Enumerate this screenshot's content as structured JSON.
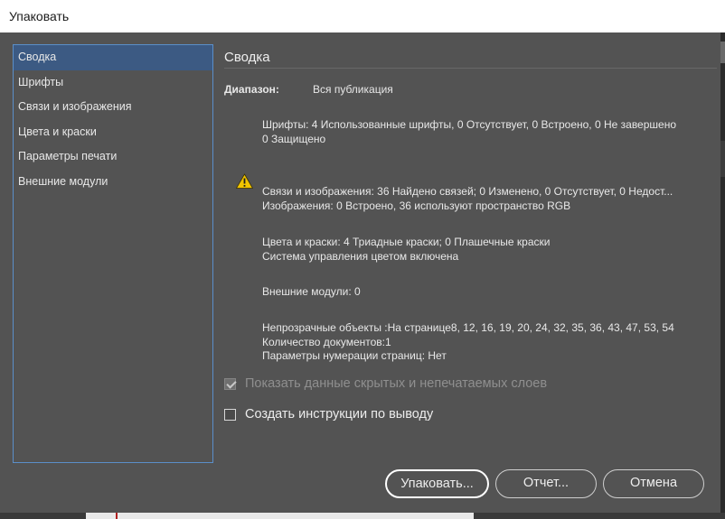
{
  "window": {
    "title": "Упаковать"
  },
  "sidebar": {
    "items": [
      {
        "label": "Сводка",
        "selected": true
      },
      {
        "label": "Шрифты",
        "selected": false
      },
      {
        "label": "Связи и изображения",
        "selected": false
      },
      {
        "label": "Цвета и краски",
        "selected": false
      },
      {
        "label": "Параметры печати",
        "selected": false
      },
      {
        "label": "Внешние модули",
        "selected": false
      }
    ]
  },
  "summary": {
    "title": "Сводка",
    "range_label": "Диапазон:",
    "range_value": "Вся публикация",
    "fonts": {
      "line1": "Шрифты: 4 Использованные шрифты, 0 Отсутствует, 0 Встроено, 0 Не завершено",
      "line2": "0 Защищено"
    },
    "links": {
      "line1": "Связи и изображения: 36 Найдено связей; 0 Изменено, 0 Отсутствует, 0 Недост...",
      "line2": "Изображения: 0 Встроено, 36 используют пространство RGB",
      "warning_icon": "warning-triangle-icon"
    },
    "colors": {
      "line1": "Цвета и краски: 4 Триадные краски; 0 Плашечные краски",
      "line2": "Система управления цветом включена"
    },
    "plugins": {
      "line1": "Внешние модули: 0"
    },
    "other": {
      "line1": "Непрозрачные объекты :На странице8, 12, 16, 19, 20, 24, 32, 35, 36, 43, 47, 53, 54",
      "line2": "Количество документов:1",
      "line3": "Параметры нумерации страниц: Нет"
    }
  },
  "options": {
    "show_hidden_label": "Показать данные скрытых и непечатаемых слоев",
    "show_hidden_checked": true,
    "show_hidden_disabled": true,
    "create_instructions_label": "Создать инструкции по выводу",
    "create_instructions_checked": false
  },
  "buttons": {
    "package": "Упаковать...",
    "report": "Отчет...",
    "cancel": "Отмена"
  },
  "colors": {
    "dialog_bg": "#535353",
    "selection": "#3c5a83",
    "sidebar_border": "#5b8fc9",
    "warning": "#f2c500"
  }
}
